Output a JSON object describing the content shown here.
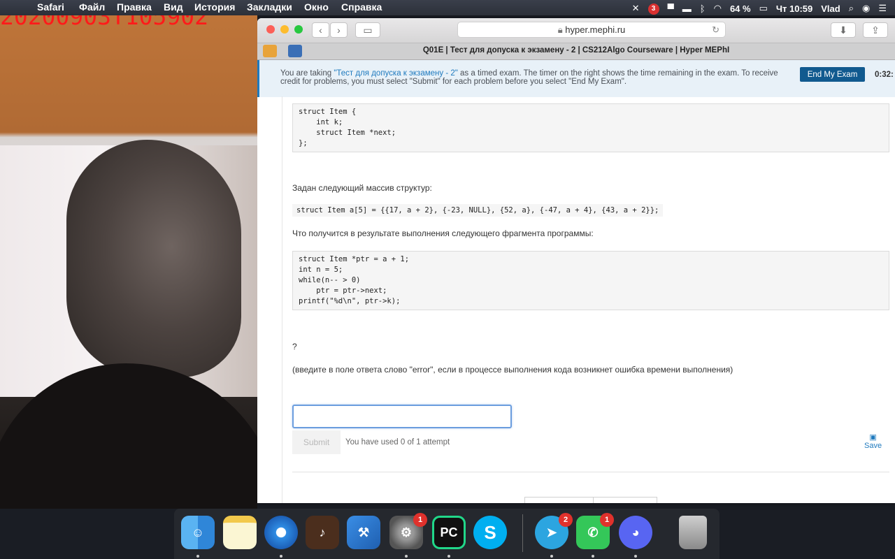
{
  "menubar": {
    "items": [
      "Safari",
      "Файл",
      "Правка",
      "Вид",
      "История",
      "Закладки",
      "Окно",
      "Справка"
    ],
    "status": {
      "notification_count": "3",
      "battery": "64 %",
      "clock": "Чт 10:59",
      "user": "Vlad"
    }
  },
  "webcam": {
    "recording_stamp": "20200903T105902"
  },
  "browser": {
    "url": "hyper.mephi.ru",
    "tab_title": "Q01E | Тест для допуска к экзамену - 2 | CS212Algo Courseware | Hyper MEPhI"
  },
  "exam_notice": {
    "text_before": "You are taking ",
    "exam_link": "\"Тест для допуска к экзамену - 2\"",
    "text_after": " as a timed exam. The timer on the right shows the time remaining in the exam. To receive credit for problems, you must select \"Submit\" for each problem before you select \"End My Exam\".",
    "end_button": "End My Exam",
    "timer": "0:32:"
  },
  "problem": {
    "struct_code": "struct Item {\n    int k;\n    struct Item *next;\n};",
    "array_intro": "Задан следующий массив структур:",
    "array_code": "struct Item a[5] = {{17, a + 2}, {-23, NULL}, {52, a}, {-47, a + 4}, {43, a + 2}};",
    "fragment_intro": "Что получится в результате выполнения следующего фрагмента программы:",
    "fragment_code": "struct Item *ptr = a + 1;\nint n = 5;\nwhile(n-- > 0)\n    ptr = ptr->next;\nprintf(\"%d\\n\", ptr->k);",
    "question_mark": "?",
    "hint": "(введите в поле ответа слово \"error\", если в процессе выполнения кода возникнет ошибка времени выполнения)",
    "answer_value": "",
    "submit_label": "Submit",
    "attempts_text": "You have used 0 of 1 attempt",
    "save_label": "Save"
  },
  "dock": {
    "apps": [
      {
        "name": "Finder",
        "icon": "finder-icon"
      },
      {
        "name": "Notes",
        "icon": "notes-icon"
      },
      {
        "name": "Safari",
        "icon": "safari-icon"
      },
      {
        "name": "GarageBand",
        "icon": "garageband-icon"
      },
      {
        "name": "Xcode",
        "icon": "xcode-icon"
      },
      {
        "name": "System Preferences",
        "icon": "gear-icon",
        "badge": "1"
      },
      {
        "name": "PyCharm",
        "icon": "pycharm-icon",
        "label": "PC"
      },
      {
        "name": "Skype",
        "icon": "skype-icon",
        "label": "S"
      },
      {
        "name": "Telegram",
        "icon": "telegram-icon",
        "badge": "2"
      },
      {
        "name": "FaceTime/Messages",
        "icon": "messages-icon",
        "badge": "1"
      },
      {
        "name": "Discord",
        "icon": "discord-icon"
      },
      {
        "name": "Trash",
        "icon": "trash-icon"
      }
    ]
  },
  "colors": {
    "link_blue": "#1f7abe",
    "end_button_bg": "#115a8f",
    "recording_red": "#ff1a1a"
  }
}
